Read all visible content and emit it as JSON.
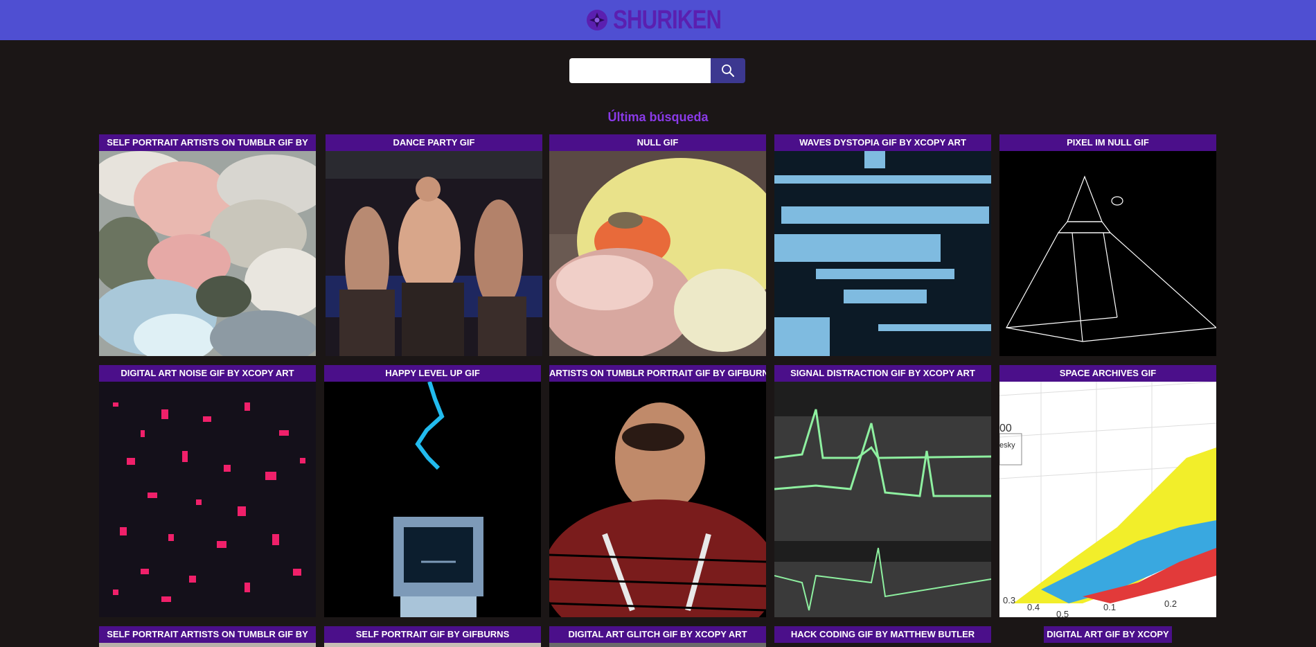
{
  "brand": {
    "name": "SHURIKEN"
  },
  "search": {
    "value": "",
    "placeholder": "",
    "icon": "search-icon"
  },
  "section_title": "Última búsqueda",
  "gifs": [
    {
      "title": "SELF PORTRAIT ARTISTS ON TUMBLR GIF BY"
    },
    {
      "title": "DANCE PARTY GIF"
    },
    {
      "title": "NULL GIF"
    },
    {
      "title": "WAVES DYSTOPIA GIF BY XCOPY ART"
    },
    {
      "title": "PIXEL IM NULL GIF"
    },
    {
      "title": "DIGITAL ART NOISE GIF BY XCOPY ART"
    },
    {
      "title": "HAPPY LEVEL UP GIF"
    },
    {
      "title": "ARTISTS ON TUMBLR PORTRAIT GIF BY GIFBURNS"
    },
    {
      "title": "SIGNAL DISTRACTION GIF BY XCOPY ART"
    },
    {
      "title": "SPACE ARCHIVES GIF"
    },
    {
      "title": "SELF PORTRAIT ARTISTS ON TUMBLR GIF BY"
    },
    {
      "title": "SELF PORTRAIT GIF BY GIFBURNS"
    },
    {
      "title": "DIGITAL ART GLITCH GIF BY XCOPY ART"
    },
    {
      "title": "HACK CODING GIF BY MATTHEW BUTLER"
    },
    {
      "title": "DIGITAL ART GIF BY XCOPY"
    }
  ],
  "chart_snippet": {
    "ticks": [
      "0.3",
      "0.4",
      "0.5",
      "0.2",
      "0.1"
    ],
    "label_00": "00",
    "label_esky": "esky"
  },
  "colors": {
    "topbar": "#4f4fd2",
    "background": "#1b1616",
    "card_title": "#4b0f8a",
    "accent": "#8a3ae8"
  }
}
